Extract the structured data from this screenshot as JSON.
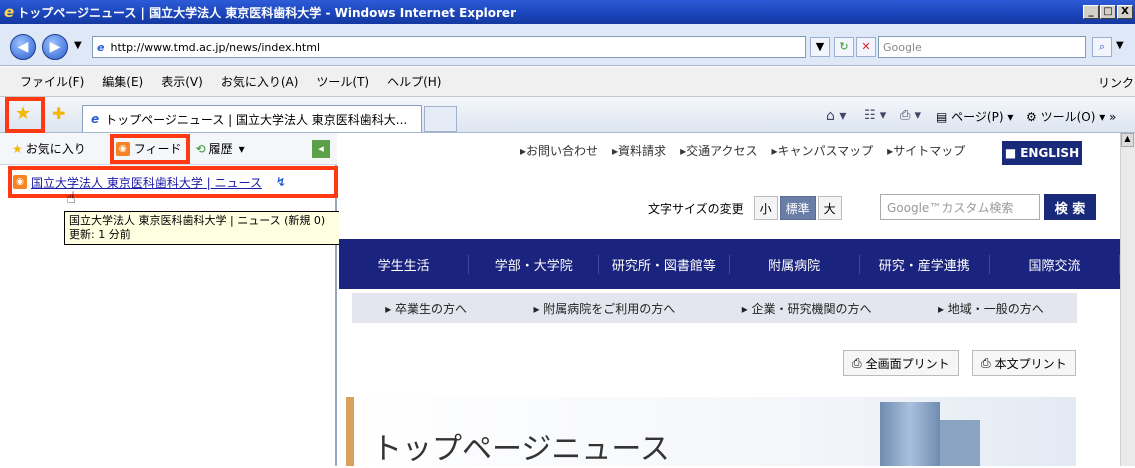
{
  "window": {
    "title": "トップページニュース | 国立大学法人 東京医科歯科大学 - Windows Internet Explorer",
    "controls": [
      "_",
      "□",
      "X"
    ]
  },
  "address_bar": {
    "url": "http://www.tmd.ac.jp/news/index.html",
    "search_placeholder": "Google"
  },
  "menu": {
    "items": [
      "ファイル(F)",
      "編集(E)",
      "表示(V)",
      "お気に入り(A)",
      "ツール(T)",
      "ヘルプ(H)"
    ],
    "links_label": "リンク"
  },
  "tabs": {
    "active_title": "トップページニュース | 国立大学法人 東京医科歯科大..."
  },
  "command_bar": {
    "page_label": "ページ(P)",
    "tools_label": "ツール(O)"
  },
  "favorites_panel": {
    "tabs": [
      "お気に入り",
      "フィード",
      "履歴"
    ],
    "feed_item": "国立大学法人 東京医科歯科大学 | ニュース",
    "tooltip_line1": "国立大学法人 東京医科歯科大学 | ニュース (新規 0)",
    "tooltip_line2": "更新: 1 分前"
  },
  "site": {
    "top_links": [
      "▸お問い合わせ",
      "▸資料請求",
      "▸交通アクセス",
      "▸キャンパスマップ",
      "▸サイトマップ"
    ],
    "english": "ENGLISH",
    "font_size_label": "文字サイズの変更",
    "font_sizes": [
      "小",
      "標準",
      "大"
    ],
    "search_placeholder": "Google™カスタム検索",
    "search_button": "検 索",
    "main_nav": [
      "学生生活",
      "学部・大学院",
      "研究所・図書館等",
      "附属病院",
      "研究・産学連携",
      "国際交流"
    ],
    "sub_nav": [
      "▸ 卒業生の方へ",
      "▸ 附属病院をご利用の方へ",
      "▸ 企業・研究機関の方へ",
      "▸ 地域・一般の方へ"
    ],
    "print_buttons": [
      "全画面プリント",
      "本文プリント"
    ],
    "hero_title": "トップページニュース"
  },
  "colors": {
    "highlight": "#ff3a12",
    "nav_bg": "#1a237e"
  }
}
